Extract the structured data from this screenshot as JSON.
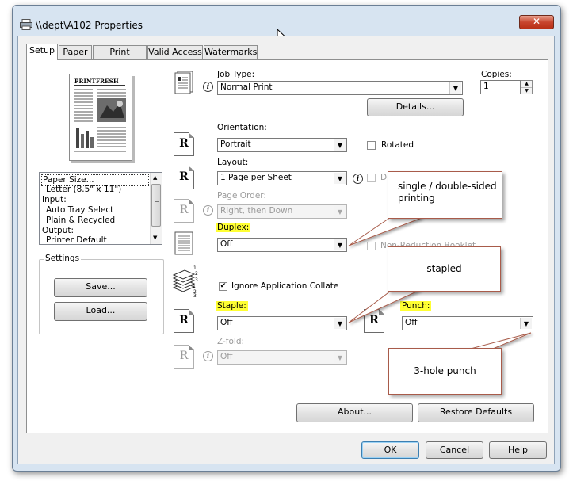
{
  "window": {
    "title": "\\\\dept\\A102 Properties",
    "close_glyph": "✕"
  },
  "tabs": [
    {
      "label": "Setup"
    },
    {
      "label": "Paper"
    },
    {
      "label": "Print Quality"
    },
    {
      "label": "Valid Access"
    },
    {
      "label": "Watermarks"
    }
  ],
  "preview": {
    "brand": "PRINTFRESH",
    "settings_list": [
      "Paper Size...",
      "Letter (8.5\" x 11\")",
      "Input:",
      "Auto Tray Select",
      "Plain & Recycled",
      "Output:",
      "Printer Default"
    ],
    "settings_group_label": "Settings",
    "save_label": "Save...",
    "load_label": "Load..."
  },
  "job_type": {
    "label": "Job Type:",
    "value": "Normal Print",
    "details_label": "Details..."
  },
  "copies": {
    "label": "Copies:",
    "value": "1"
  },
  "orientation": {
    "label": "Orientation:",
    "value": "Portrait",
    "rotated_label": "Rotated"
  },
  "layout": {
    "label": "Layout:",
    "value": "1 Page per Sheet",
    "truncated_label": "D"
  },
  "page_order": {
    "label": "Page Order:",
    "value": "Right, then Down"
  },
  "duplex": {
    "label": "Duplex:",
    "value": "Off",
    "booklet_label": "Non-Reduction Booklet"
  },
  "ignore_collate": {
    "label": "Ignore Application Collate",
    "checked": true,
    "check_glyph": "✔"
  },
  "staple": {
    "label": "Staple:",
    "value": "Off"
  },
  "punch": {
    "label": "Punch:",
    "value": "Off"
  },
  "zfold": {
    "label": "Z-fold:",
    "value": "Off"
  },
  "orientation_icon_glyph": "R",
  "buttons": {
    "about": "About...",
    "restore": "Restore Defaults",
    "ok": "OK",
    "cancel": "Cancel",
    "help": "Help"
  },
  "callouts": {
    "duplex": "single / double-sided printing",
    "staple": "stapled",
    "punch": "3-hole punch"
  },
  "colors": {
    "highlight": "#ffff33",
    "callout_border": "#a85b4a",
    "window_frame": "#d7e4f1"
  },
  "icons": [
    "printer-icon",
    "close-icon",
    "info-icon",
    "dropdown-arrow-icon",
    "orientation-r-icon",
    "duplex-icon",
    "collate-stack-icon",
    "document-icon",
    "mouse-cursor-icon"
  ]
}
